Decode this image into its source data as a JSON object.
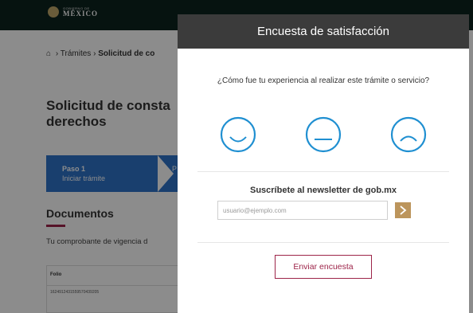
{
  "header": {
    "gov_small": "GOBIERNO DE",
    "gov_big": "MÉXICO"
  },
  "breadcrumb": {
    "home_icon": "home-icon",
    "sep": "›",
    "item1": "Trámites",
    "current": "Solicitud de co"
  },
  "page": {
    "title": "Solicitud de consta derechos",
    "step1_label": "Paso 1",
    "step1_desc": "Iniciar trámite",
    "step2_partial": "P",
    "documents_title": "Documentos",
    "vigencia_text": "Tu comprobante de vigencia d",
    "table_header": "Folio",
    "table_cell": "16249124315595704392​05"
  },
  "modal": {
    "title": "Encuesta de satisfacción",
    "question": "¿Cómo fue tu experiencia al realizar este trámite o servicio?",
    "faces": [
      "happy-face-icon",
      "neutral-face-icon",
      "sad-face-icon"
    ],
    "newsletter_title": "Suscríbete al newsletter de gob.mx",
    "email_placeholder": "usuario@ejemplo.com",
    "send_label": "Enviar encuesta"
  },
  "colors": {
    "accent_blue": "#2f73c9",
    "face_blue": "#1f8fd1",
    "brand_burgundy": "#9d2449",
    "gold": "#bc955c",
    "header_dark": "#0c231e"
  }
}
